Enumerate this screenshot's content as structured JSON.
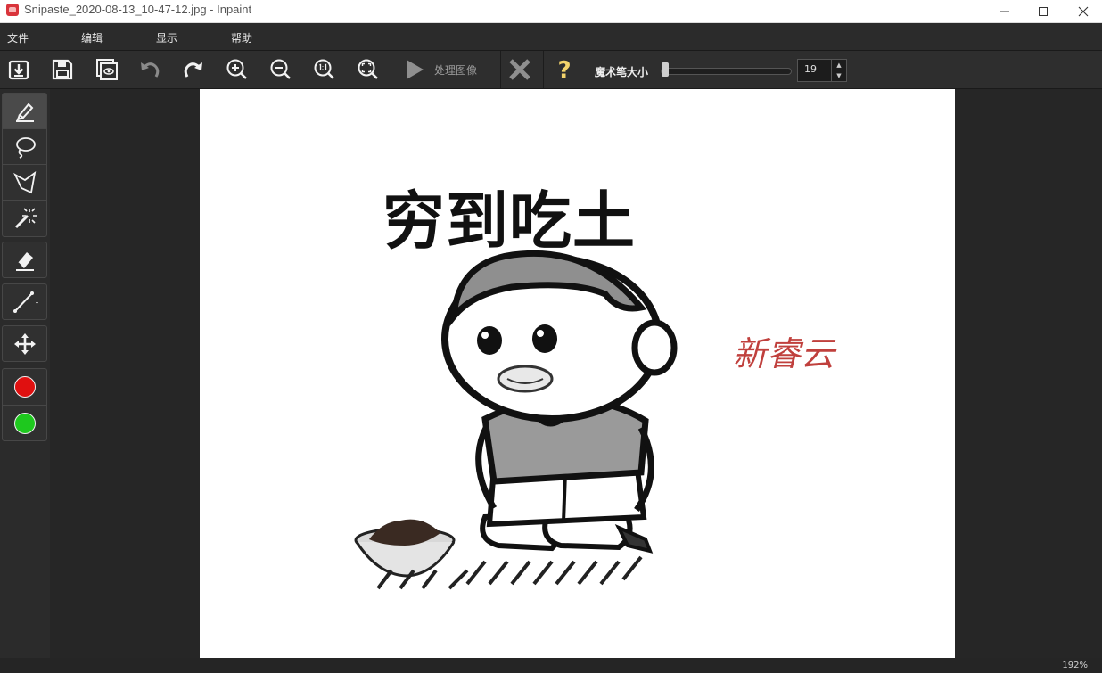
{
  "window": {
    "title": "Snipaste_2020-08-13_10-47-12.jpg - Inpaint",
    "app_icon": "inpaint-app-icon",
    "controls": {
      "minimize": "—",
      "maximize": "☐",
      "close": "✕"
    }
  },
  "menu": {
    "items": [
      {
        "label": "文件"
      },
      {
        "label": "编辑"
      },
      {
        "label": "显示"
      },
      {
        "label": "帮助"
      }
    ]
  },
  "toolbar": {
    "icons": [
      "open-icon",
      "save-icon",
      "preview-icon",
      "undo-icon",
      "redo-icon",
      "zoom-in-icon",
      "zoom-out-icon",
      "zoom-actual-icon",
      "zoom-fit-icon"
    ],
    "process_label": "处理图像",
    "process_enabled": false,
    "brush_size_label": "魔术笔大小",
    "brush_size_value": "19",
    "brush_size_slider_fraction": 0.03
  },
  "left_tools": {
    "tools": [
      "marker-icon",
      "lasso-icon",
      "polygon-lasso-icon",
      "magic-wand-icon",
      "eraser-icon",
      "line-icon",
      "move-icon"
    ],
    "active_tool": "marker-icon",
    "colors": {
      "remove_color": "#e01010",
      "keep_color": "#1ec81e"
    }
  },
  "image": {
    "title_text": "穷到吃土",
    "watermark_text": "新睿云"
  },
  "status": {
    "zoom": "192%"
  }
}
